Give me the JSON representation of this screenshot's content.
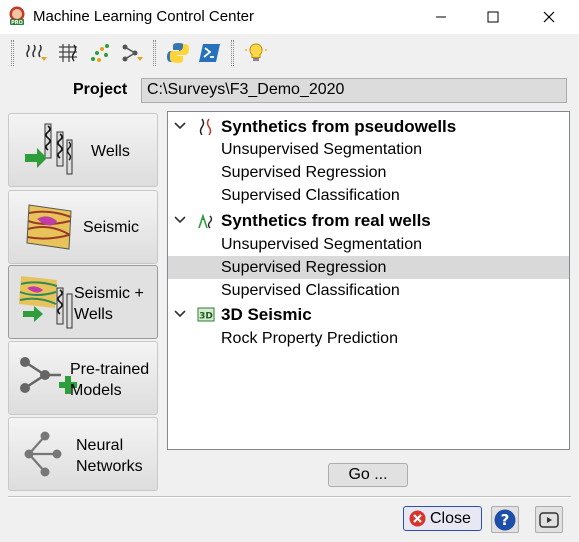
{
  "window": {
    "title": "Machine Learning Control Center",
    "icon": "opendtect-pro-icon"
  },
  "toolbar": {
    "items": [
      {
        "icon": "wells-extract-icon"
      },
      {
        "icon": "seismic-wells-grid-icon"
      },
      {
        "icon": "scatter-points-icon"
      },
      {
        "icon": "neural-network-import-icon"
      },
      {
        "icon": "python-icon"
      },
      {
        "icon": "powershell-icon"
      },
      {
        "icon": "lightbulb-icon"
      }
    ]
  },
  "project": {
    "label": "Project",
    "value": "C:\\Surveys\\F3_Demo_2020"
  },
  "side_buttons": [
    {
      "label": "Wells",
      "icon": "wells-icon"
    },
    {
      "label": "Seismic",
      "icon": "seismic-icon"
    },
    {
      "label": "Seismic +\nWells",
      "icon": "seismic-wells-icon",
      "active": true
    },
    {
      "label": "Pre-trained\nModels",
      "icon": "pretrained-models-icon"
    },
    {
      "label": "Neural\nNetworks",
      "icon": "neural-networks-icon"
    }
  ],
  "tree": {
    "groups": [
      {
        "label": "Synthetics from pseudowells",
        "icon": "pseudowell-synthetics-icon",
        "items": [
          "Unsupervised Segmentation",
          "Supervised Regression",
          "Supervised Classification"
        ]
      },
      {
        "label": "Synthetics from real wells",
        "icon": "real-well-synthetics-icon",
        "items": [
          "Unsupervised Segmentation",
          "Supervised Regression",
          "Supervised Classification"
        ],
        "selected_item": "Supervised Regression"
      },
      {
        "label": "3D Seismic",
        "icon": "3d-seismic-icon",
        "items": [
          "Rock Property Prediction"
        ]
      }
    ]
  },
  "buttons": {
    "go": "Go ...",
    "close": "Close",
    "help_icon": "help-icon",
    "video_icon": "video-icon"
  },
  "colors": {
    "selected_row": "#d9d9d9",
    "close_border": "#2c4fb8",
    "help_blue": "#1e4fa8",
    "green_arrow": "#2e9e3a"
  }
}
